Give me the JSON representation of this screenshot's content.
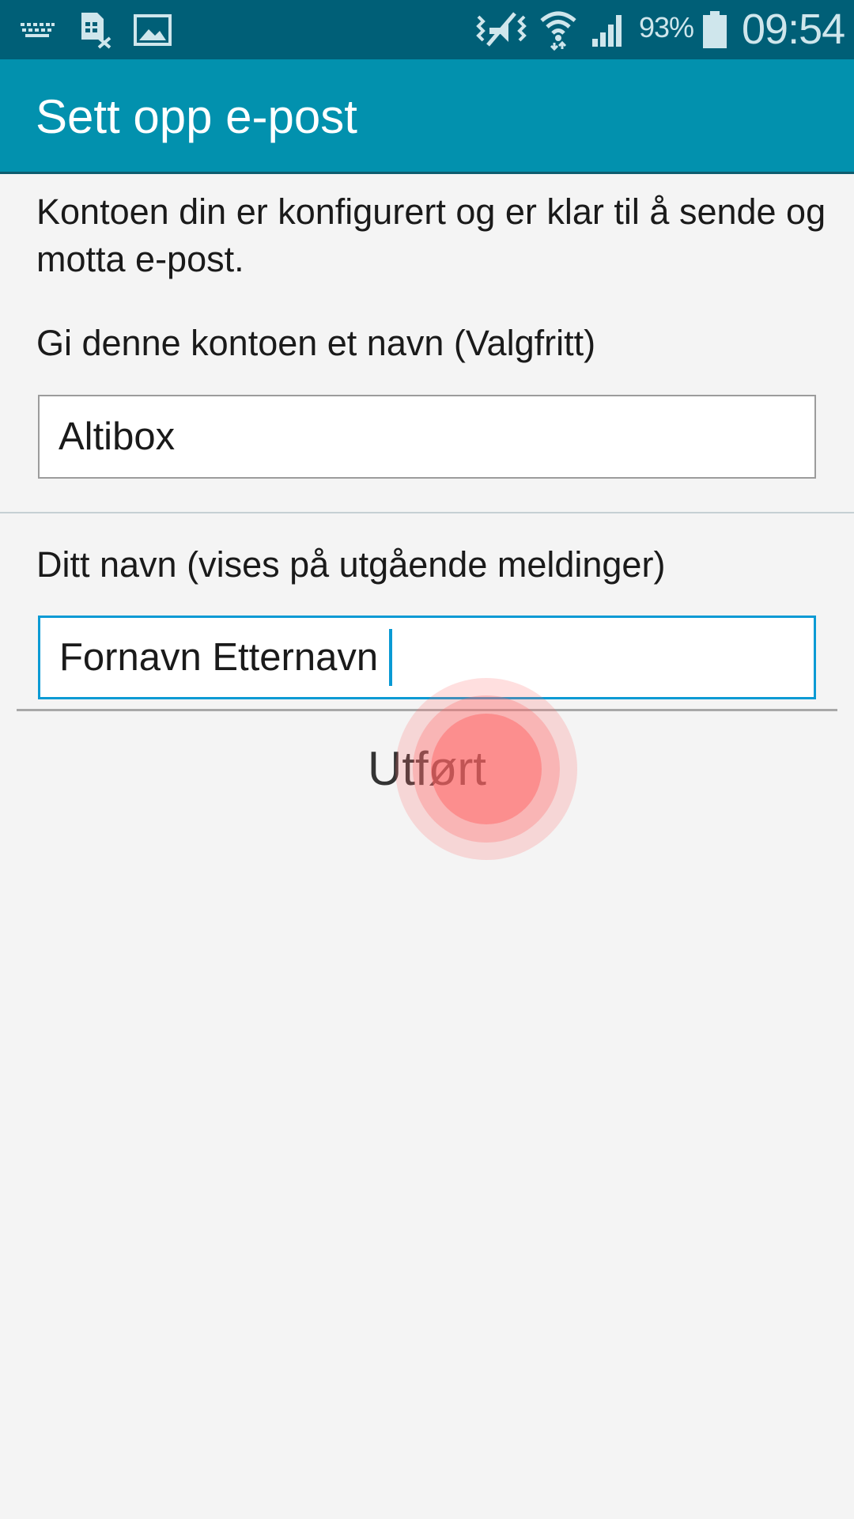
{
  "status_bar": {
    "battery_percent": "93%",
    "time": "09:54",
    "icons": [
      "keyboard-icon",
      "sim-card-off-icon",
      "image-icon",
      "vibrate-mute-icon",
      "wifi-icon",
      "signal-icon",
      "battery-icon"
    ],
    "icon_color": "#cfe6ec"
  },
  "action_bar": {
    "title": "Sett opp e-post",
    "color": "#0291ae"
  },
  "content": {
    "intro": "Kontoen din er konfigurert og er klar til å sende og motta e-post.",
    "account_name_label": "Gi denne kontoen et navn (Valgfritt)",
    "account_name_value": "Altibox",
    "your_name_label": "Ditt navn (vises på utgående meldinger)",
    "your_name_value": "Fornavn Etternavn",
    "focus_color": "#0a9ad4"
  },
  "actions": {
    "done_label": "Utført"
  }
}
